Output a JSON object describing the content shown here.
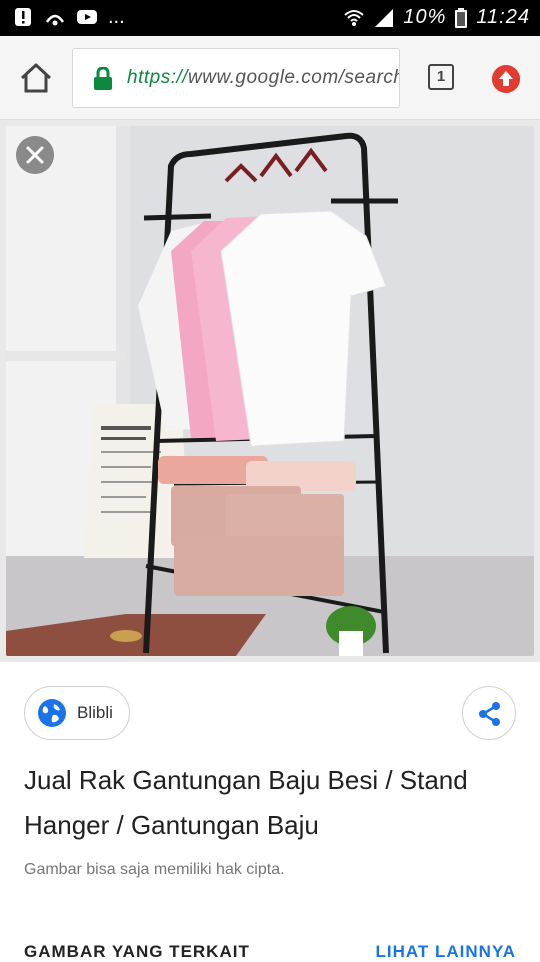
{
  "status_bar": {
    "battery_percent": "10%",
    "time": "11:24",
    "more_indicator": "..."
  },
  "browser": {
    "url_scheme": "https://",
    "url_rest": "www.google.com/search",
    "tab_count": "1"
  },
  "icons": {
    "home": "home-icon",
    "lock": "lock-icon",
    "tabs": "tab-switcher-icon",
    "update": "update-icon",
    "close": "close-icon",
    "globe": "globe-icon",
    "share": "share-icon"
  },
  "result": {
    "source_label": "Blibli",
    "title": "Jual Rak Gantungan Baju Besi / Stand Hanger / Gantungan Baju",
    "copyright_note": "Gambar bisa saja memiliki hak cipta."
  },
  "related": {
    "heading": "GAMBAR YANG TERKAIT",
    "more_link": "LIHAT LAINNYA"
  },
  "colors": {
    "url_scheme": "#0a8a3d",
    "accent_link": "#1a73e8",
    "update_badge": "#e03c31",
    "globe": "#1a73e8"
  }
}
